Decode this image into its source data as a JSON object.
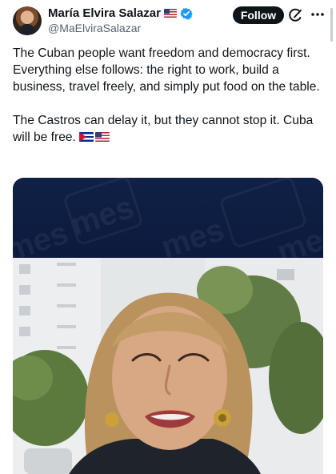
{
  "author": {
    "display_name": "María Elvira Salazar",
    "handle": "@MaElviraSalazar",
    "verified": true,
    "flag_icon": "us-flag-emoji",
    "avatar_icon": "profile-avatar"
  },
  "actions": {
    "follow_label": "Follow",
    "grok_icon": "grok-icon",
    "more_icon": "more-horizontal-icon"
  },
  "tweet": {
    "paragraph_1": "The Cuban people want freedom and democracy first. Everything else follows: the right to work, build a business, travel freely, and simply put food on the table.",
    "paragraph_2": "The Castros can delay it, but they cannot stop it. Cuba will be free.",
    "emoji_flags": [
      "cuba-flag-emoji",
      "us-flag-emoji"
    ]
  },
  "media": {
    "type": "video",
    "watermark_text": "mes"
  },
  "colors": {
    "text": "#0f1419",
    "secondary_text": "#536471",
    "verified_blue": "#1d9bf0",
    "follow_button_bg": "#0f1419",
    "video_banner_bg": "#0c1a3e"
  }
}
